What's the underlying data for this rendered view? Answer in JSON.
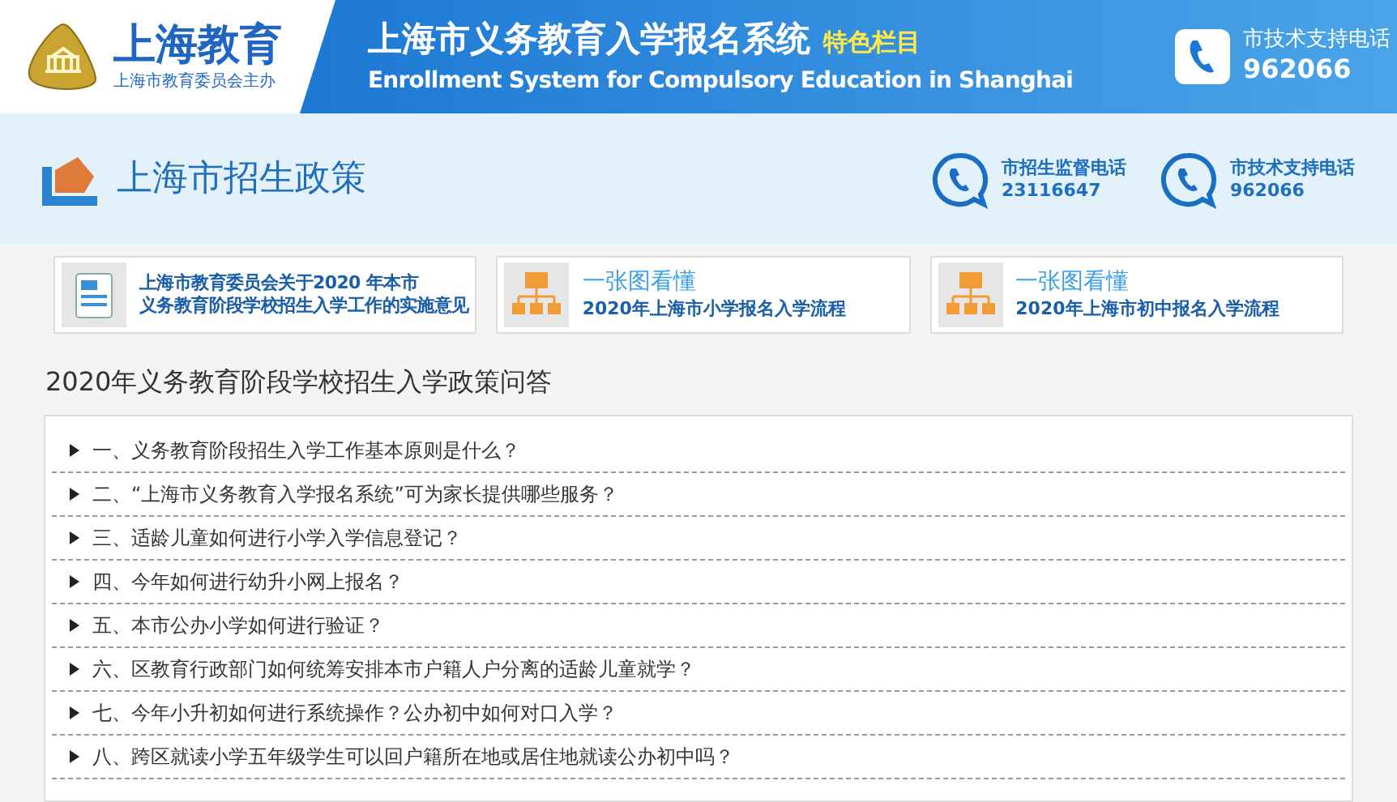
{
  "header": {
    "logo_title": "上海教育",
    "logo_subtitle": "上海市教育委员会主办",
    "system_title": "上海市义务教育入学报名系统",
    "badge": "特色栏目",
    "system_subtitle": "Enrollment System for Compulsory Education in Shanghai",
    "support_label": "市技术支持电话",
    "support_number": "962066"
  },
  "section": {
    "title": "上海市招生政策",
    "hotlines": [
      {
        "label": "市招生监督电话",
        "number": "23116647"
      },
      {
        "label": "市技术支持电话",
        "number": "962066"
      }
    ]
  },
  "cards": [
    {
      "kind": "document",
      "lines": [
        "上海市教育委员会关于2020 年本市",
        "义务教育阶段学校招生入学工作的实施意见"
      ]
    },
    {
      "kind": "flow",
      "lines": [
        "一张图看懂",
        "2020年上海市小学报名入学流程"
      ]
    },
    {
      "kind": "flow",
      "lines": [
        "一张图看懂",
        "2020年上海市初中报名入学流程"
      ]
    }
  ],
  "faq": {
    "title": "2020年义务教育阶段学校招生入学政策问答",
    "items": [
      {
        "text": "一、义务教育阶段招生入学工作基本原则是什么？",
        "expanded": false
      },
      {
        "text": "二、“上海市义务教育入学报名系统”可为家长提供哪些服务？",
        "expanded": false
      },
      {
        "text": "三、适龄儿童如何进行小学入学信息登记？",
        "expanded": false
      },
      {
        "text": "四、今年如何进行幼升小网上报名？",
        "expanded": false
      },
      {
        "text": "五、本市公办小学如何进行验证？",
        "expanded": false
      },
      {
        "text": "六、区教育行政部门如何统筹安排本市户籍人户分离的适龄儿童就学？",
        "expanded": false
      },
      {
        "text": "七、今年小升初如何进行系统操作？公办初中如何对口入学？",
        "expanded": false
      },
      {
        "text": "八、跨区就读小学五年级学生可以回户籍所在地或居住地就读公办初中吗？",
        "expanded": false
      }
    ]
  }
}
